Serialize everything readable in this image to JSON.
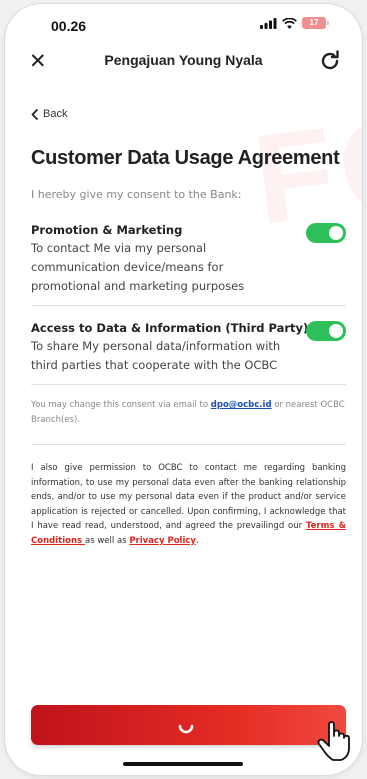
{
  "status_bar": {
    "time": "00.26",
    "battery": "17"
  },
  "nav": {
    "title": "Pengajuan Young Nyala"
  },
  "back": {
    "label": "Back"
  },
  "watermark": "FO",
  "page": {
    "title": "Customer Data Usage Agreement",
    "intro": "I hereby give my consent to the Bank:"
  },
  "consents": [
    {
      "title": "Promotion & Marketing",
      "desc": "To contact Me via my personal communication device/means for promotional and marketing purposes",
      "enabled": true
    },
    {
      "title": "Access to Data & Information (Third Party)",
      "desc": "To share My personal data/information with third parties that cooperate with the OCBC",
      "enabled": true
    }
  ],
  "note": {
    "before": "You may change this consent via email to ",
    "email": "dpo@ocbc.id",
    "after": " or nearest OCBC Branch(es)."
  },
  "legal": {
    "text": "I also give permission to OCBC to contact me regarding banking information, to use my personal data even after the banking relationship ends, and/or to use my personal data even if the product and/or service application is rejected or cancelled. Upon confirming, I acknowledge that I have read read, understood, and agreed the prevailingd our ",
    "terms": "Terms & Conditions ",
    "mid": "as well as ",
    "privacy": "Privacy Policy",
    "end": "."
  },
  "colors": {
    "accent": "#e52c25",
    "toggle_on": "#2fbf5a",
    "link": "#1c4fb8"
  }
}
